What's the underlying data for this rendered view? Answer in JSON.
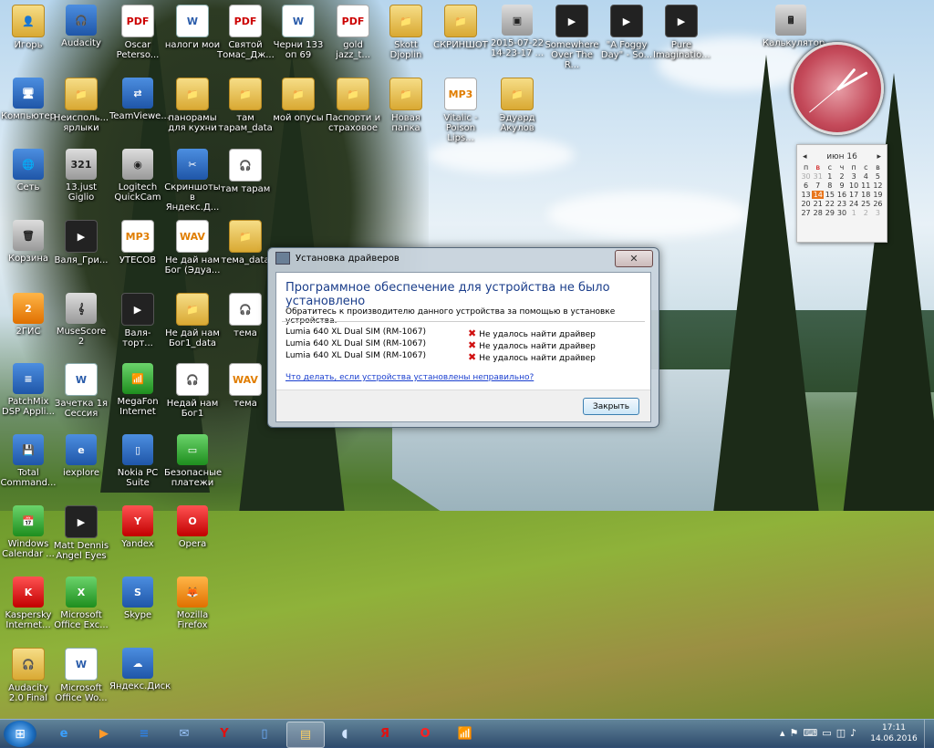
{
  "desktop_icons": [
    {
      "label": "Игорь",
      "glyph": "👤",
      "type": "folder"
    },
    {
      "label": "Audacity",
      "glyph": "🎧",
      "type": "app"
    },
    {
      "label": "Oscar Peterso...",
      "glyph": "PDF",
      "type": "pdf"
    },
    {
      "label": "налоги мои",
      "glyph": "W",
      "type": "doc"
    },
    {
      "label": "Святой Томас_Дж...",
      "glyph": "PDF",
      "type": "pdf"
    },
    {
      "label": "Черни 133 оп 69",
      "glyph": "W",
      "type": "doc"
    },
    {
      "label": "gold jazz_t...",
      "glyph": "PDF",
      "type": "pdf"
    },
    {
      "label": "Skott Djoplin",
      "glyph": "📁",
      "type": "folder"
    },
    {
      "label": "СКРИНШОТ",
      "glyph": "📁",
      "type": "folder"
    },
    {
      "label": "2015-07-22 14-23-17 ...",
      "glyph": "▣",
      "type": "gray"
    },
    {
      "label": "Somewhere Over The R...",
      "glyph": "▶",
      "type": "video"
    },
    {
      "label": "\"A Foggy Day\" - So...",
      "glyph": "▶",
      "type": "video"
    },
    {
      "label": "Pure Imaginatio...",
      "glyph": "▶",
      "type": "video"
    },
    {
      "label": "Калькулятор",
      "glyph": "🖩",
      "type": "gray"
    },
    {
      "label": "Компьютер",
      "glyph": "🖥",
      "type": "app"
    },
    {
      "label": "Неисполь... ярлыки",
      "glyph": "📁",
      "type": "folder"
    },
    {
      "label": "TeamViewe...",
      "glyph": "⇄",
      "type": "app"
    },
    {
      "label": "панорамы для кухни",
      "glyph": "📁",
      "type": "folder"
    },
    {
      "label": "там тарам_data",
      "glyph": "📁",
      "type": "folder"
    },
    {
      "label": "мой опусы",
      "glyph": "📁",
      "type": "folder"
    },
    {
      "label": "Паспорти и страховое",
      "glyph": "📁",
      "type": "folder"
    },
    {
      "label": "Новая папка",
      "glyph": "📁",
      "type": "folder"
    },
    {
      "label": "Vitalic - Poison Lips...",
      "glyph": "MP3",
      "type": "audio"
    },
    {
      "label": "Эдуард Акулов",
      "glyph": "📁",
      "type": "folder"
    },
    {
      "label": "Сеть",
      "glyph": "🌐",
      "type": "app"
    },
    {
      "label": "13.just Giglio",
      "glyph": "321",
      "type": "gray"
    },
    {
      "label": "Logitech QuickCam",
      "glyph": "◉",
      "type": "gray"
    },
    {
      "label": "Скриншоты в Яндекс.Д...",
      "glyph": "✂",
      "type": "app"
    },
    {
      "label": "там тарам",
      "glyph": "🎧",
      "type": "audio"
    },
    {
      "label": "Корзина",
      "glyph": "🗑",
      "type": "gray"
    },
    {
      "label": "Валя_Гри...",
      "glyph": "▶",
      "type": "video"
    },
    {
      "label": "УТЕСОВ",
      "glyph": "MP3",
      "type": "audio"
    },
    {
      "label": "Не дай нам Бог (Эдуа...",
      "glyph": "WAV",
      "type": "audio"
    },
    {
      "label": "тема_data",
      "glyph": "📁",
      "type": "folder"
    },
    {
      "label": "2ГИС",
      "glyph": "2",
      "type": "orange"
    },
    {
      "label": "MuseScore 2",
      "glyph": "𝄞",
      "type": "gray"
    },
    {
      "label": "Валя-торт...",
      "glyph": "▶",
      "type": "video"
    },
    {
      "label": "Не дай нам Бог1_data",
      "glyph": "📁",
      "type": "folder"
    },
    {
      "label": "тема",
      "glyph": "🎧",
      "type": "audio"
    },
    {
      "label": "PatchMix DSP Appli...",
      "glyph": "≡",
      "type": "app"
    },
    {
      "label": "Зачетка 1я Сессия",
      "glyph": "W",
      "type": "doc"
    },
    {
      "label": "MegaFon Internet",
      "glyph": "📶",
      "type": "green"
    },
    {
      "label": "Недай нам Бог1",
      "glyph": "🎧",
      "type": "audio"
    },
    {
      "label": "тема",
      "glyph": "WAV",
      "type": "audio"
    },
    {
      "label": "Total Command...",
      "glyph": "💾",
      "type": "app"
    },
    {
      "label": "iexplore",
      "glyph": "e",
      "type": "app"
    },
    {
      "label": "Nokia PC Suite",
      "glyph": "▯",
      "type": "app"
    },
    {
      "label": "Безопасные платежи",
      "glyph": "▭",
      "type": "green"
    },
    {
      "label": "Windows Calendar ...",
      "glyph": "📅",
      "type": "green"
    },
    {
      "label": "Matt Dennis Angel Eyes",
      "glyph": "▶",
      "type": "video"
    },
    {
      "label": "Yandex",
      "glyph": "Y",
      "type": "red"
    },
    {
      "label": "Opera",
      "glyph": "O",
      "type": "red"
    },
    {
      "label": "Kaspersky Internet...",
      "glyph": "K",
      "type": "red"
    },
    {
      "label": "Microsoft Office Exc...",
      "glyph": "X",
      "type": "green"
    },
    {
      "label": "Skype",
      "glyph": "S",
      "type": "app"
    },
    {
      "label": "Mozilla Firefox",
      "glyph": "🦊",
      "type": "orange"
    },
    {
      "label": "Audacity 2.0 Final",
      "glyph": "🎧",
      "type": "folder"
    },
    {
      "label": "Microsoft Office Wo...",
      "glyph": "W",
      "type": "doc"
    },
    {
      "label": "Яндекс.Диск",
      "glyph": "☁",
      "type": "app"
    }
  ],
  "calendar": {
    "month_label": "июн 16",
    "weekdays": [
      "п",
      "в",
      "с",
      "ч",
      "п",
      "с",
      "в"
    ],
    "days": [
      "30",
      "31",
      "1",
      "2",
      "3",
      "4",
      "5",
      "6",
      "7",
      "8",
      "9",
      "10",
      "11",
      "12",
      "13",
      "14",
      "15",
      "16",
      "17",
      "18",
      "19",
      "20",
      "21",
      "22",
      "23",
      "24",
      "25",
      "26",
      "27",
      "28",
      "29",
      "30",
      "1",
      "2",
      "3"
    ],
    "today": "14",
    "prev_icon": "◂",
    "next_icon": "▸"
  },
  "dialog": {
    "title": "Установка драйверов",
    "close_glyph": "✕",
    "heading": "Программное обеспечение для устройства не было установлено",
    "subtitle": "Обратитесь к производителю данного устройства за помощью в установке устройства.",
    "rows": [
      {
        "device": "Lumia 640 XL Dual SIM (RM-1067)",
        "status": "Не удалось найти драйвер"
      },
      {
        "device": "Lumia 640 XL Dual SIM (RM-1067)",
        "status": "Не удалось найти драйвер"
      },
      {
        "device": "Lumia 640 XL Dual SIM (RM-1067)",
        "status": "Не удалось найти драйвер"
      }
    ],
    "error_glyph": "✖",
    "link": "Что делать, если устройства установлены неправильно?",
    "button": "Закрыть"
  },
  "taskbar": {
    "start_glyph": "⊞",
    "buttons": [
      {
        "glyph": "e",
        "color": "#3aa0ff"
      },
      {
        "glyph": "▶",
        "color": "#ff9a2a"
      },
      {
        "glyph": "≡",
        "color": "#2f7fe0"
      },
      {
        "glyph": "✉",
        "color": "#9cc7ff"
      },
      {
        "glyph": "Y",
        "color": "#e01010"
      },
      {
        "glyph": "▯",
        "color": "#6fb0ff"
      },
      {
        "glyph": "▤",
        "color": "#ffd060"
      },
      {
        "glyph": "◖",
        "color": "#cfe3ff"
      },
      {
        "glyph": "Я",
        "color": "#e01010"
      },
      {
        "glyph": "O",
        "color": "#ff2020"
      },
      {
        "glyph": "📶",
        "color": "#42c742"
      }
    ],
    "tray_icons": [
      "▴",
      "⚑",
      "⌨",
      "▭",
      "◫",
      "♪"
    ],
    "time": "17:11",
    "date": "14.06.2016"
  }
}
